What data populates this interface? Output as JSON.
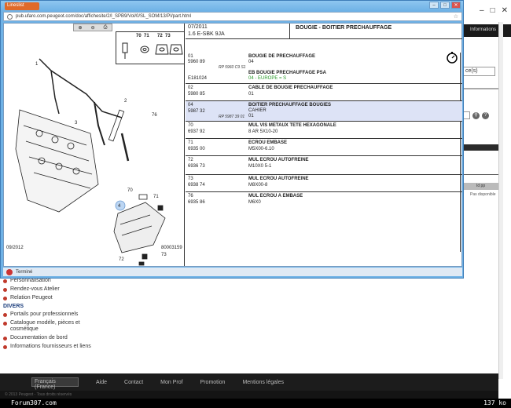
{
  "popup": {
    "tab_label": "Lineslist",
    "address": "pub.ufaro.com.peugeot.com/doc/affichesite/2/l_SPB9/Vol/0/SL_SOM/13/PI/part.html",
    "status_text": "Terminé"
  },
  "diagram": {
    "date": "09/2012",
    "code": "80003159",
    "legend_labels": [
      "70",
      "71",
      "72",
      "73"
    ],
    "callouts": [
      "1",
      "2",
      "3",
      "4",
      "70",
      "71",
      "72",
      "73",
      "76"
    ]
  },
  "parts": {
    "header_date": "07/2011",
    "header_model": "1.6 E-SBK 9JA",
    "title": "BOUGIE - BOITIER PRECHAUFFAGE",
    "rows": [
      {
        "rn": "01",
        "ref": "5960 89",
        "qty": "04",
        "desc": "BOUGIE DE PRECHAUFFAGE",
        "tag": "RP 5960 C9 S1",
        "ref2": "E181024",
        "desc2": "EB BOUGIE PRECHAUFFAGE PSA",
        "desc3": "04 - EUROPE = S"
      },
      {
        "rn": "02",
        "ref": "5980 85",
        "qty": "01",
        "desc": "CABLE DE BOUGIE PRECHAUFFAGE",
        "tag": "",
        "ref2": "",
        "desc2": "",
        "desc3": ""
      },
      {
        "rn": "04",
        "ref": "5987 32",
        "qty": "01",
        "desc": "BOITIER PRECHAUFFAGE BOUGIES",
        "tag": "RP 5987 39 01",
        "ref2": "",
        "desc2": "CAHIER",
        "desc3": ""
      },
      {
        "rn": "70",
        "ref": "6937 92",
        "qty": "01",
        "desc": "MUL VIS METAUX TETE HEXAGONALE",
        "tag": "",
        "ref2": "",
        "desc2": "8 AR 5X10-20",
        "desc3": ""
      },
      {
        "rn": "71",
        "ref": "6935 00",
        "qty": "01",
        "desc": "ECROU EMBASE",
        "tag": "",
        "ref2": "",
        "desc2": "M5X00-6.10",
        "desc3": ""
      },
      {
        "rn": "72",
        "ref": "6936 73",
        "qty": "01",
        "desc": "MUL ECROU AUTOFREINE",
        "tag": "",
        "ref2": "",
        "desc2": "M10X0 5-1",
        "desc3": ""
      },
      {
        "rn": "73",
        "ref": "6938 74",
        "qty": "01",
        "desc": "MUL ECROU AUTOFREINE",
        "tag": "",
        "ref2": "",
        "desc2": "M8X00-8",
        "desc3": ""
      },
      {
        "rn": "76",
        "ref": "6935 86",
        "qty": "01",
        "desc": "MUL ECROU A EMBASE",
        "tag": "",
        "ref2": "",
        "desc2": "M6X0",
        "desc3": ""
      }
    ]
  },
  "background": {
    "window_controls": [
      "–",
      "□",
      "✕"
    ],
    "black_bar_text": "Informations",
    "input_tag": "ce(s)",
    "table_head": "Id pp",
    "table_cell": "Pas disponible",
    "nav": {
      "items_top": [
        "Personnalisation",
        "Rendez-vous Atelier",
        "Relation Peugeot"
      ],
      "section_head": "DIVERS",
      "items_bottom": [
        "Portails pour professionnels",
        "Catalogue modéle, pièces et cosmétique",
        "Documentation de bord",
        "Informations fournisseurs et liens"
      ]
    },
    "footer": {
      "select_label": "Français (France)",
      "links": [
        "Aide",
        "Contact",
        "Mon Prof",
        "Promotion",
        "Mentions légales"
      ],
      "sub_text": "© 2013 Peugeot - Tous droits réservés"
    },
    "status_left": "Forum307.com",
    "status_right": "137 ko"
  }
}
